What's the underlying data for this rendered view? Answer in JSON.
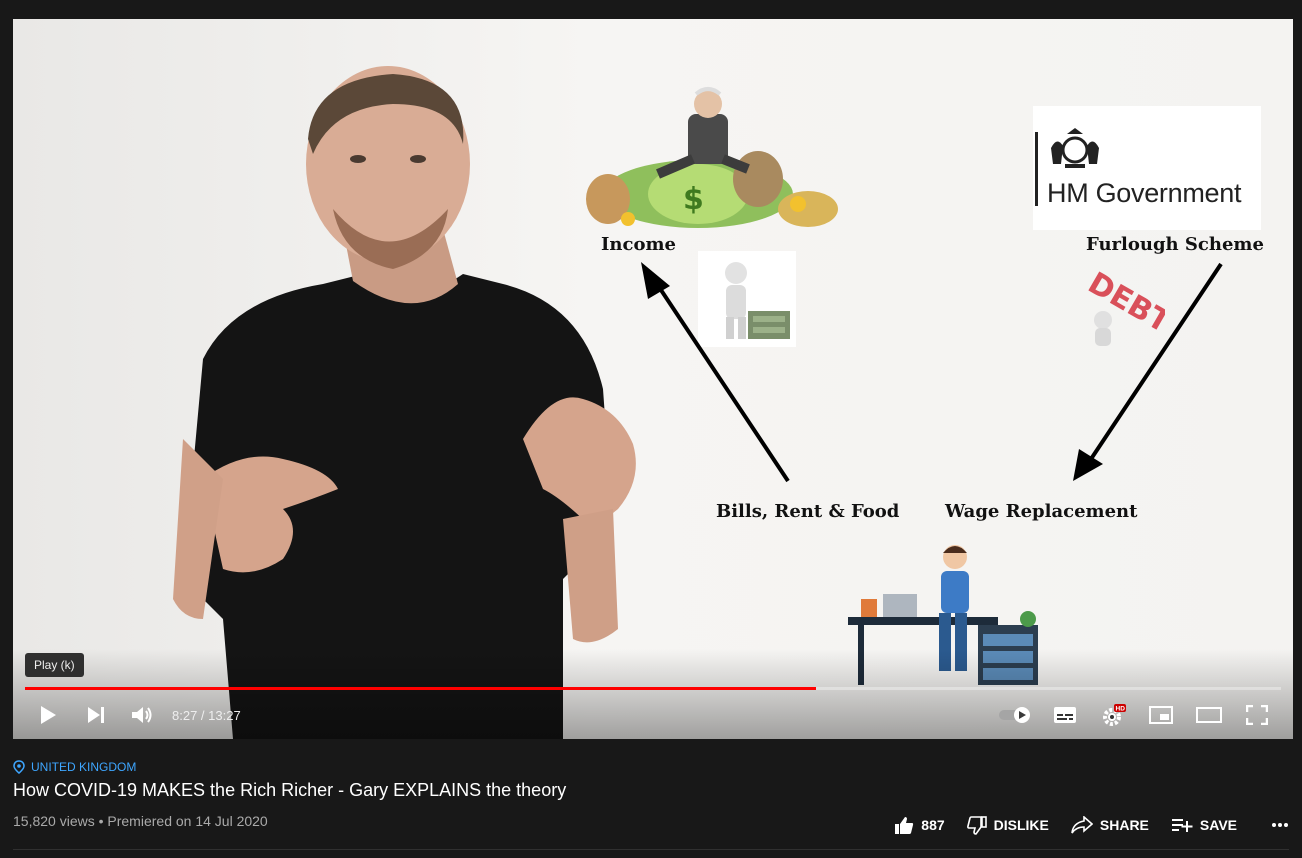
{
  "player": {
    "tooltip": "Play (k)",
    "time_display": "8:27 / 13:27",
    "progress_fraction": 0.6294,
    "accent": "#ff0000",
    "settings_badge": "HD",
    "autoplay_on": true
  },
  "diagram": {
    "income": "Income",
    "furlough": "Furlough Scheme",
    "bills": "Bills, Rent & Food",
    "wage": "Wage Replacement",
    "gov_name": "HM Government",
    "debt_word": "DEBT"
  },
  "video": {
    "location": "UNITED KINGDOM",
    "title": "How COVID-19 MAKES the Rich Richer - Gary EXPLAINS the theory",
    "views_line": "15,820 views • Premiered on 14 Jul 2020"
  },
  "actions": {
    "like_count": "887",
    "dislike_label": "DISLIKE",
    "share_label": "SHARE",
    "save_label": "SAVE"
  },
  "icons": [
    "play-icon",
    "next-icon",
    "volume-icon",
    "autoplay-toggle-icon",
    "captions-icon",
    "settings-icon",
    "miniplayer-icon",
    "theater-icon",
    "fullscreen-icon",
    "location-pin-icon",
    "thumbs-up-icon",
    "thumbs-down-icon",
    "share-icon",
    "save-playlist-icon",
    "more-icon"
  ]
}
